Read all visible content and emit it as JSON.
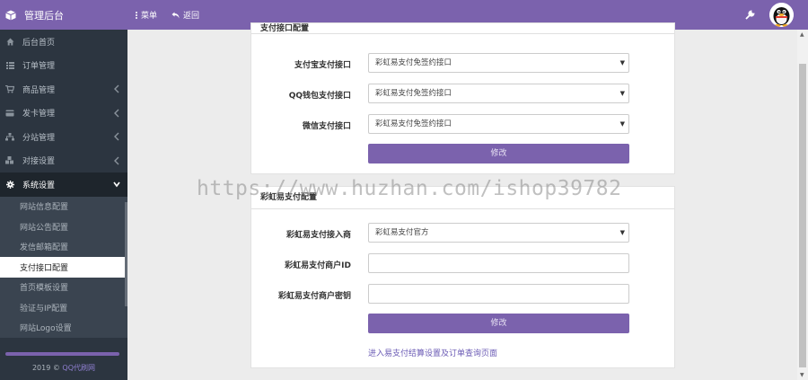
{
  "brand": {
    "title": "管理后台"
  },
  "sidebar": {
    "items": [
      {
        "label": "后台首页",
        "icon": "home-icon"
      },
      {
        "label": "订单管理",
        "icon": "list-icon"
      },
      {
        "label": "商品管理",
        "icon": "cart-icon",
        "has_children": true
      },
      {
        "label": "发卡管理",
        "icon": "card-icon",
        "has_children": true
      },
      {
        "label": "分站管理",
        "icon": "sitemap-icon",
        "has_children": true
      },
      {
        "label": "对接设置",
        "icon": "cubes-icon",
        "has_children": true
      },
      {
        "label": "系统设置",
        "icon": "gear-icon",
        "has_children": true,
        "expanded": true
      }
    ],
    "sub_items": [
      {
        "label": "网站信息配置"
      },
      {
        "label": "网站公告配置"
      },
      {
        "label": "发信邮箱配置"
      },
      {
        "label": "支付接口配置",
        "current": true
      },
      {
        "label": "首页模板设置"
      },
      {
        "label": "验证与IP配置"
      },
      {
        "label": "网站Logo设置"
      }
    ],
    "footer": {
      "year": "2019 ©",
      "link": "QQ代刷网"
    }
  },
  "header": {
    "menu_label": "菜单",
    "back_label": "返回"
  },
  "panel1": {
    "title": "支付接口配置",
    "rows": [
      {
        "label": "支付宝支付接口",
        "value": "彩虹易支付免签约接口"
      },
      {
        "label": "QQ钱包支付接口",
        "value": "彩虹易支付免签约接口"
      },
      {
        "label": "微信支付接口",
        "value": "彩虹易支付免签约接口"
      }
    ],
    "submit_label": "修改"
  },
  "panel2": {
    "title": "彩虹易支付配置",
    "rows": [
      {
        "label": "彩虹易支付接入商",
        "value": "彩虹易支付官方"
      },
      {
        "label": "彩虹易支付商户ID",
        "value": ""
      },
      {
        "label": "彩虹易支付商户密钥",
        "value": ""
      }
    ],
    "submit_label": "修改",
    "link_label": "进入易支付结算设置及订单查询页面"
  },
  "watermark": "https://www.huzhan.com/ishop39782",
  "colors": {
    "accent": "#7b62ad",
    "sidebar": "#2c3540",
    "sidebar_active": "#1e252c"
  }
}
